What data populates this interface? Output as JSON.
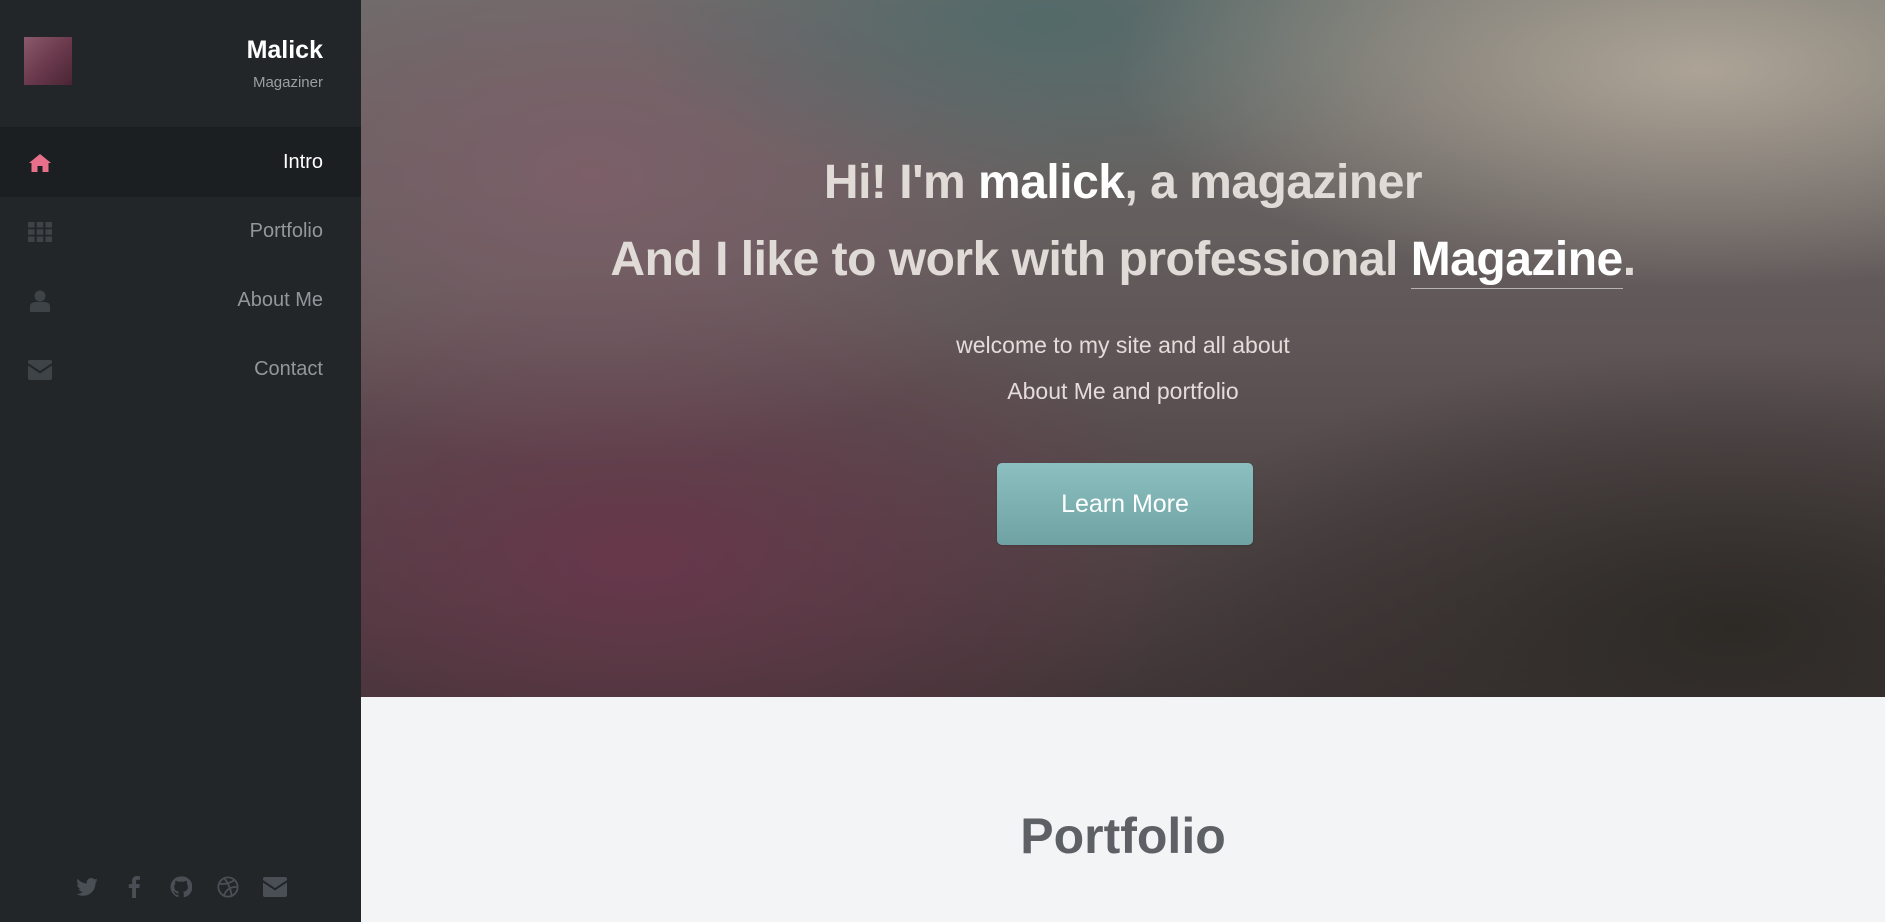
{
  "profile": {
    "name": "Malick",
    "role": "Magaziner"
  },
  "nav": [
    {
      "label": "Intro",
      "icon": "home-icon",
      "active": true
    },
    {
      "label": "Portfolio",
      "icon": "grid-icon",
      "active": false
    },
    {
      "label": "About Me",
      "icon": "user-icon",
      "active": false
    },
    {
      "label": "Contact",
      "icon": "envelope-icon",
      "active": false
    }
  ],
  "social": [
    "twitter-icon",
    "facebook-icon",
    "github-icon",
    "dribbble-icon",
    "envelope-icon"
  ],
  "hero": {
    "line1_pre": "Hi! I'm ",
    "line1_name": "malick",
    "line1_post": ", a magaziner",
    "line2_pre": "And I like to work with professional ",
    "line2_highlight": "Magazine",
    "line2_post": ".",
    "sub1": "welcome to my site and all about",
    "sub2": "About Me and portfolio",
    "button": "Learn More"
  },
  "portfolio": {
    "title": "Portfolio"
  },
  "colors": {
    "accent": "#e8708a",
    "button": "#7db1b2",
    "sidebar": "#222629",
    "icon_muted": "#3e4348"
  }
}
